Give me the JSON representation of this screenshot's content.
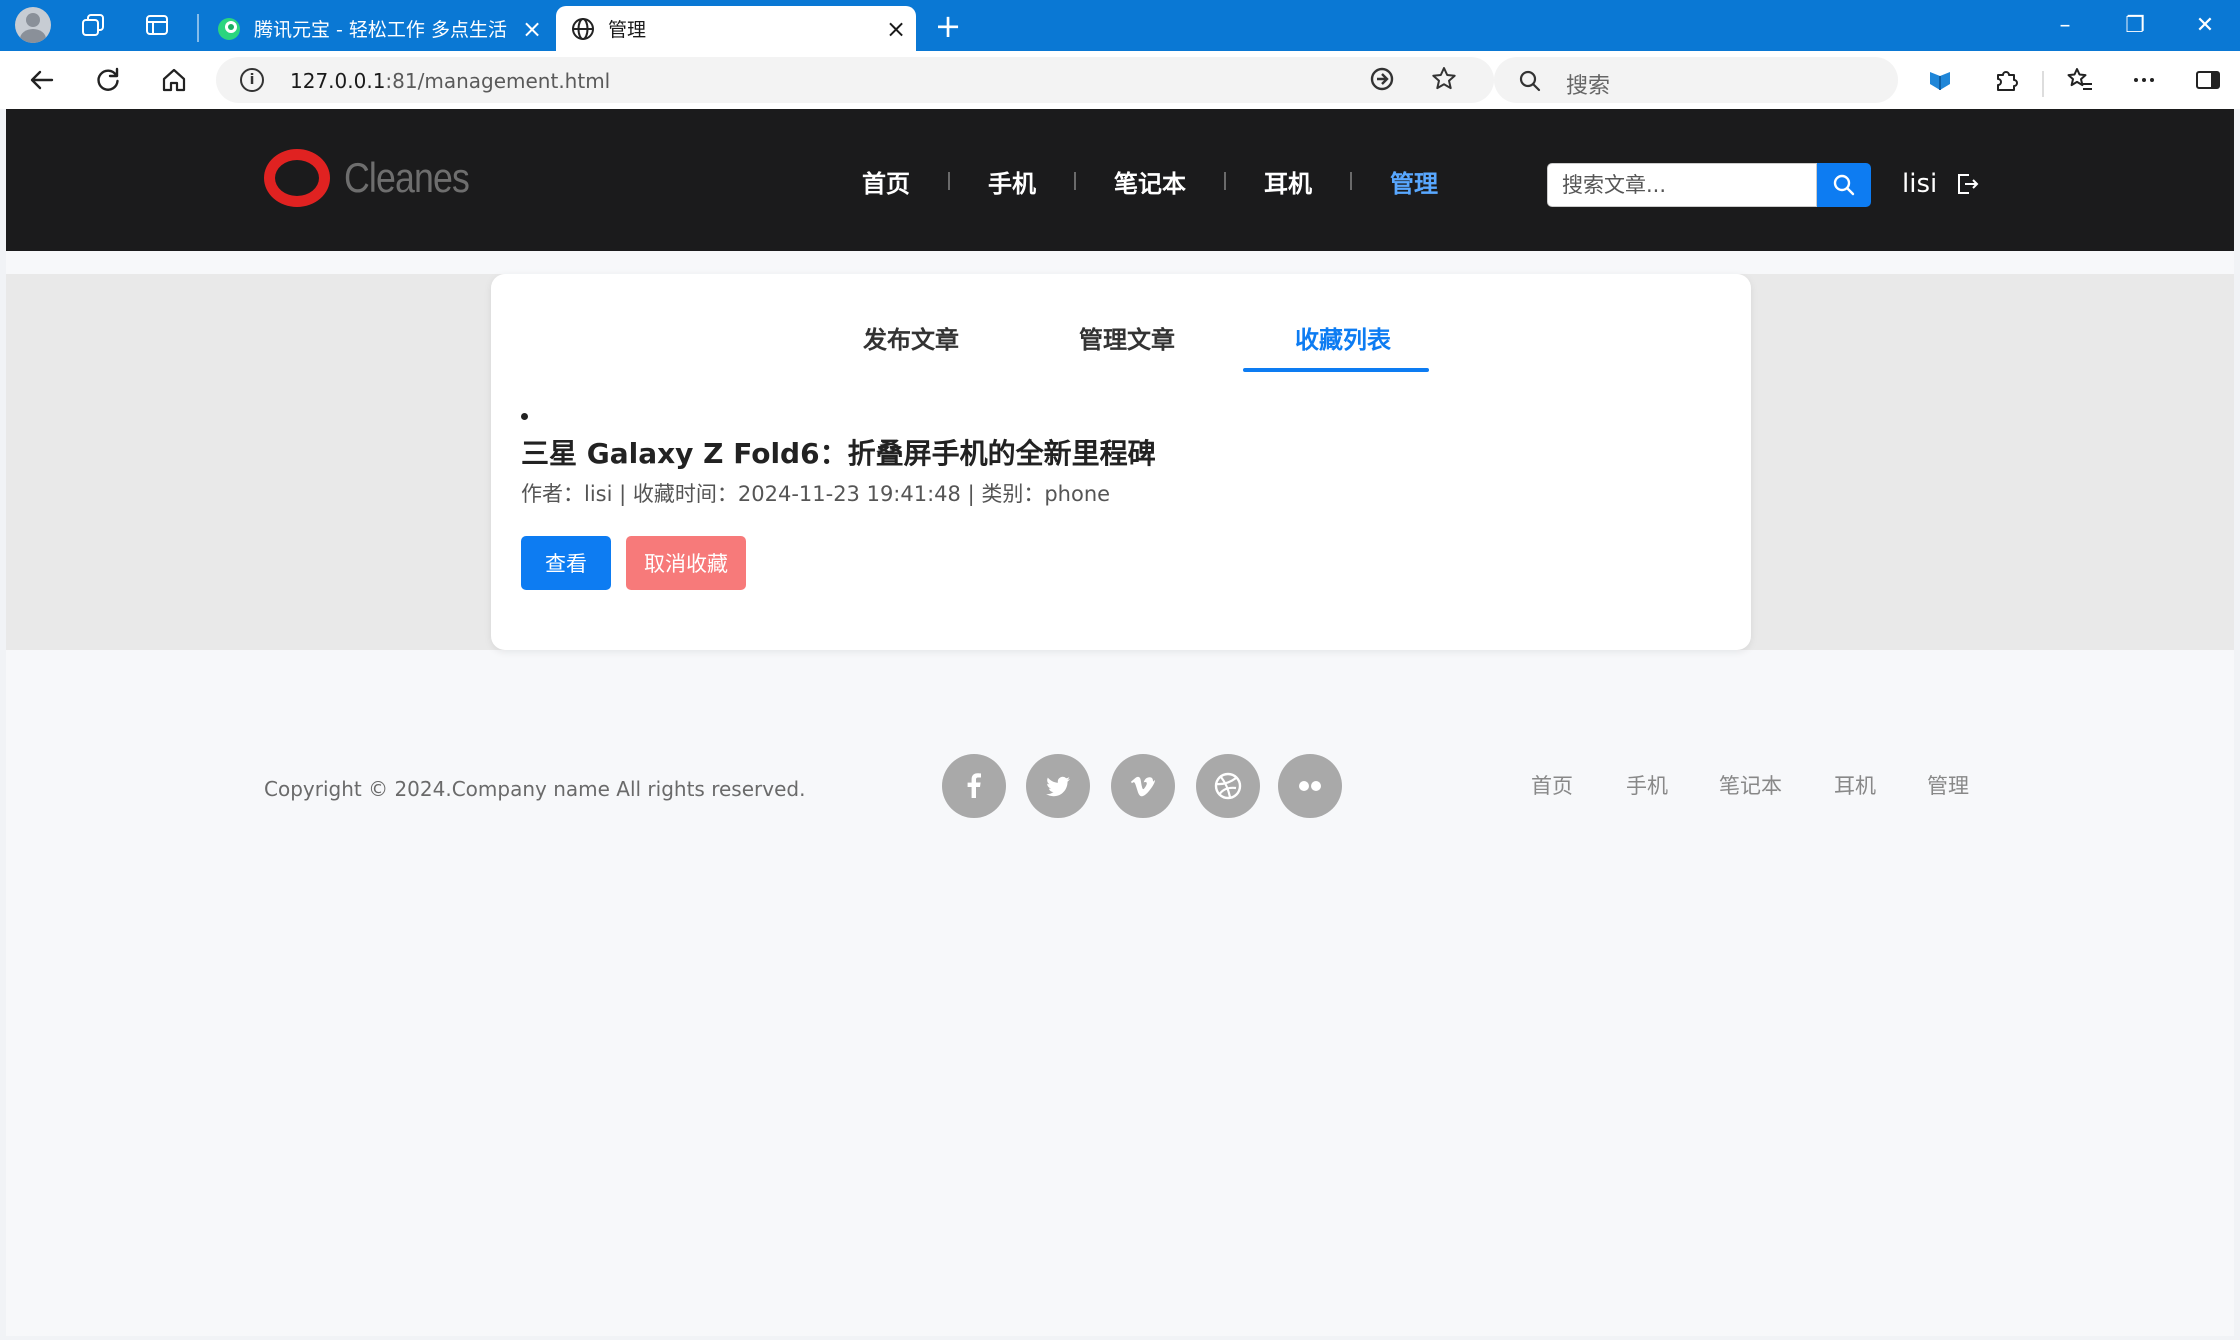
{
  "browser": {
    "tabs": [
      {
        "title": "腾讯元宝 - 轻松工作 多点生活",
        "close": "×"
      },
      {
        "title": "管理",
        "close": "×"
      }
    ],
    "new_tab": "+",
    "window_controls": {
      "minimize": "–",
      "restore": "❐",
      "close": "✕"
    },
    "url": {
      "host": "127.0.0.1",
      "path": ":81/management.html"
    },
    "search_placeholder": "搜索",
    "icons": [
      "profile-avatar",
      "workspaces-icon",
      "tab-actions-icon",
      "back-icon",
      "refresh-icon",
      "home-icon",
      "info-icon",
      "read-aloud-icon",
      "favorite-star-icon",
      "search-icon",
      "extension-icon",
      "puzzle-icon",
      "favorites-icon",
      "more-icon",
      "sidebar-icon"
    ]
  },
  "site": {
    "logo_text": "Cleanes",
    "nav": [
      "首页",
      "手机",
      "笔记本",
      "耳机",
      "管理"
    ],
    "active_nav": "管理",
    "search_placeholder": "搜索文章...",
    "user": "lisi",
    "accent": "#0d7cf2"
  },
  "management": {
    "tabs": [
      "发布文章",
      "管理文章",
      "收藏列表"
    ],
    "active_tab": "收藏列表",
    "favorites": [
      {
        "title": "三星 Galaxy Z Fold6：折叠屏手机的全新里程碑",
        "meta": "作者：lisi | 收藏时间：2024-11-23 19:41:48 | 类别：phone",
        "view_label": "查看",
        "unfav_label": "取消收藏"
      }
    ]
  },
  "footer": {
    "copyright": "Copyright © 2024.Company name All rights reserved.",
    "social": [
      "facebook-icon",
      "twitter-icon",
      "vimeo-icon",
      "dribbble-icon",
      "flickr-icon"
    ],
    "links": [
      "首页",
      "手机",
      "笔记本",
      "耳机",
      "管理"
    ]
  }
}
